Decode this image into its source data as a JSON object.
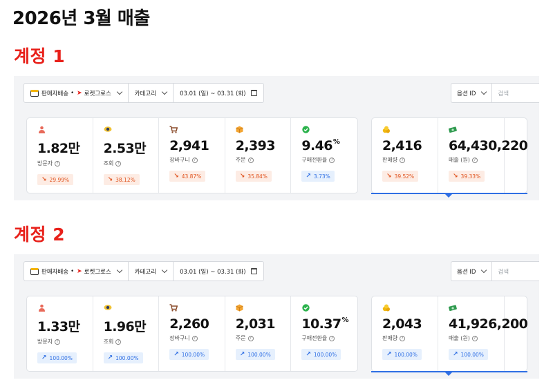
{
  "page_title": "2026년 3월 매출",
  "accounts": [
    {
      "title": "계정 1",
      "filters": {
        "channel_a": "판매자배송",
        "separator": "•",
        "channel_b": "로켓그로스",
        "category": "카테고리",
        "date_range": "03.01 (일) ~ 03.31 (화)"
      },
      "right": {
        "option_id": "옵션 ID",
        "search_placeholder": "검색"
      },
      "metrics": [
        {
          "icon": "person-icon",
          "value": "1.82만",
          "label": "방문자",
          "change": "29.99%",
          "direction": "down"
        },
        {
          "icon": "eye-icon",
          "value": "2.53만",
          "label": "조회",
          "change": "38.12%",
          "direction": "down"
        },
        {
          "icon": "cart-icon",
          "value": "2,941",
          "label": "장바구니",
          "change": "43.87%",
          "direction": "down"
        },
        {
          "icon": "box-icon",
          "value": "2,393",
          "label": "주문",
          "change": "35.84%",
          "direction": "down"
        },
        {
          "icon": "check-icon",
          "value": "9.46",
          "unit": "%",
          "label": "구매전환율",
          "change": "3.73%",
          "direction": "up"
        }
      ],
      "sales": [
        {
          "icon": "coins-icon",
          "value": "2,416",
          "label": "판매량",
          "change": "39.52%",
          "direction": "down"
        },
        {
          "icon": "money-icon",
          "value": "64,430,220",
          "label": "매출 (원)",
          "change": "39.33%",
          "direction": "down"
        }
      ]
    },
    {
      "title": "계정 2",
      "filters": {
        "channel_a": "판매자배송",
        "separator": "•",
        "channel_b": "로켓그로스",
        "category": "카테고리",
        "date_range": "03.01 (일) ~ 03.31 (화)"
      },
      "right": {
        "option_id": "옵션 ID",
        "search_placeholder": "검색"
      },
      "metrics": [
        {
          "icon": "person-icon",
          "value": "1.33만",
          "label": "방문자",
          "change": "100.00%",
          "direction": "up"
        },
        {
          "icon": "eye-icon",
          "value": "1.96만",
          "label": "조회",
          "change": "100.00%",
          "direction": "up"
        },
        {
          "icon": "cart-icon",
          "value": "2,260",
          "label": "장바구니",
          "change": "100.00%",
          "direction": "up"
        },
        {
          "icon": "box-icon",
          "value": "2,031",
          "label": "주문",
          "change": "100.00%",
          "direction": "up"
        },
        {
          "icon": "check-icon",
          "value": "10.37",
          "unit": "%",
          "label": "구매전환율",
          "change": "100.00%",
          "direction": "up"
        }
      ],
      "sales": [
        {
          "icon": "coins-icon",
          "value": "2,043",
          "label": "판매량",
          "change": "100.00%",
          "direction": "up"
        },
        {
          "icon": "money-icon",
          "value": "41,926,200",
          "label": "매출 (원)",
          "change": "100.00%",
          "direction": "up"
        }
      ]
    }
  ]
}
